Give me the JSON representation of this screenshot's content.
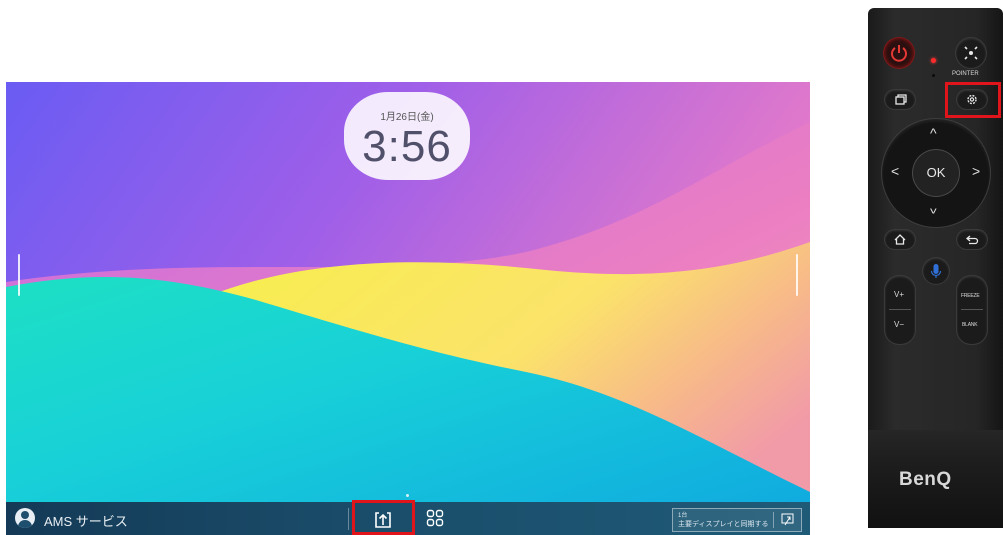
{
  "screen": {
    "clock": {
      "date": "1月26日(金)",
      "time": "3:56"
    },
    "taskbar": {
      "user_name": "AMS サービス",
      "share_icon": "screen-share-icon",
      "apps_icon": "apps-grid-icon",
      "sync": {
        "count": "1台",
        "label": "主要ディスプレイと同期する",
        "icon": "cast-icon"
      }
    }
  },
  "remote": {
    "pointer_label": "POINTER",
    "ok_label": "OK",
    "vol_up": "V+",
    "vol_down": "V−",
    "freeze_label": "FREEZE",
    "blank_label": "BLANK",
    "brand": "BenQ",
    "icons": [
      "power-icon",
      "pointer-icon",
      "window-icon",
      "settings-icon",
      "home-icon",
      "back-icon",
      "microphone-icon"
    ]
  },
  "colors": {
    "highlight": "#e0141b",
    "power": "#e53935",
    "mic": "#2f6fd6"
  }
}
